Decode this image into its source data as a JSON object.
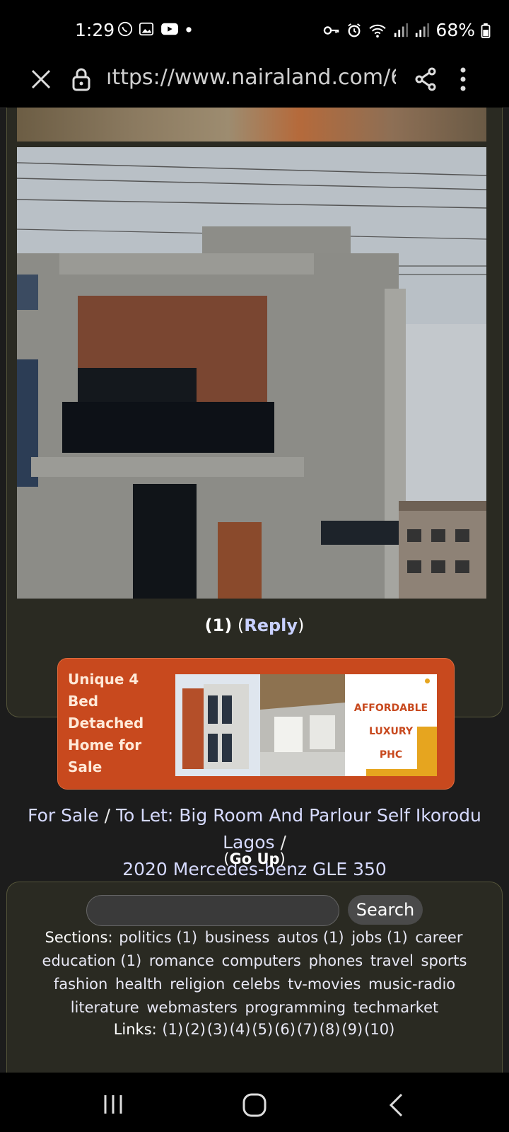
{
  "status_bar": {
    "time": "1:29",
    "battery": "68%",
    "notification_icons": [
      "whatsapp-icon",
      "gallery-icon",
      "youtube-icon",
      "dot-icon"
    ],
    "system_icons": [
      "key-icon",
      "alarm-icon",
      "wifi-icon",
      "signal-icon",
      "signal-icon",
      "battery-icon"
    ]
  },
  "browser": {
    "url": "ıttps://www.nairaland.com/6"
  },
  "post": {
    "reply_count": "(1)",
    "reply_label": "Reply"
  },
  "ad": {
    "headline": "Unique 4 Bed Detached Home for Sale",
    "tagline_1": "AFFORDABLE",
    "tagline_2": "LUXURY",
    "tagline_3": "PHC"
  },
  "breadcrumb": {
    "item1": "For Sale",
    "item2": "To Let: Big Room And Parlour Self Ikorodu Lagos",
    "item3": "2020 Mercedes-benz GLE 350",
    "separator": "/"
  },
  "go_up": "Go Up",
  "footer": {
    "search_placeholder": "",
    "search_button": "Search",
    "sections_label": "Sections:",
    "sections": [
      "politics (1)",
      "business",
      "autos (1)",
      "jobs (1)",
      "career",
      "education (1)",
      "romance",
      "computers",
      "phones",
      "travel",
      "sports",
      "fashion",
      "health",
      "religion",
      "celebs",
      "tv-movies",
      "music-radio",
      "literature",
      "webmasters",
      "programming",
      "techmarket"
    ],
    "links_label": "Links:",
    "links": [
      "(1)",
      "(2)",
      "(3)",
      "(4)",
      "(5)",
      "(6)",
      "(7)",
      "(8)",
      "(9)",
      "(10)"
    ]
  }
}
